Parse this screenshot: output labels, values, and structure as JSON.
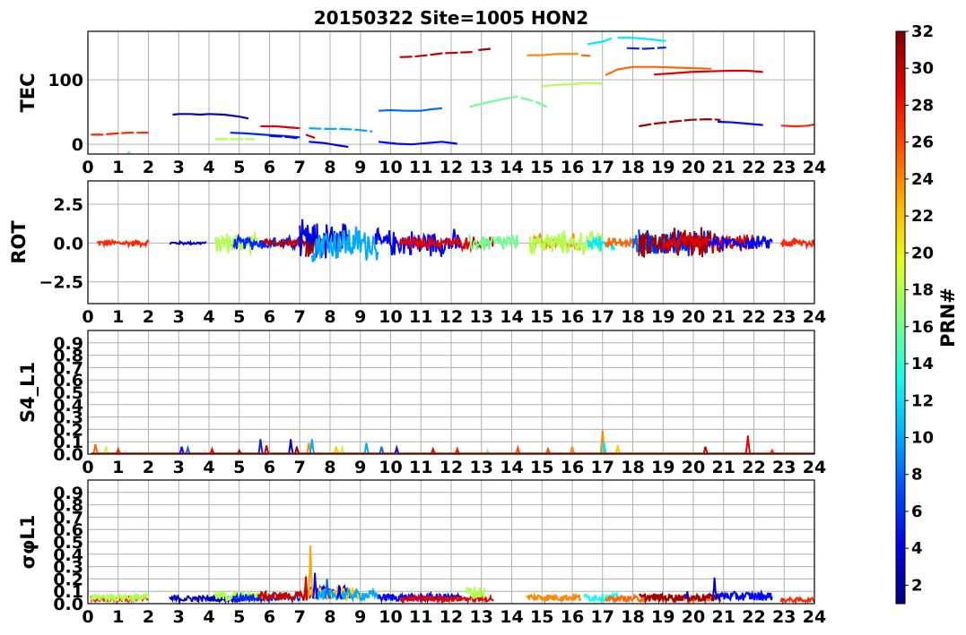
{
  "chart_data": {
    "title": "20150322 Site=1005 HON2",
    "x_range": [
      0,
      24
    ],
    "x_ticks": [
      "0",
      "1",
      "2",
      "3",
      "4",
      "5",
      "6",
      "7",
      "8",
      "9",
      "10",
      "11",
      "12",
      "13",
      "14",
      "15",
      "16",
      "17",
      "18",
      "19",
      "20",
      "21",
      "22",
      "23",
      "24"
    ],
    "grid": true,
    "colorbar": {
      "label": "PRN#",
      "colormap": "jet",
      "range": [
        1,
        32
      ],
      "ticks": [
        "2",
        "4",
        "6",
        "8",
        "10",
        "12",
        "14",
        "16",
        "18",
        "20",
        "22",
        "24",
        "26",
        "28",
        "30",
        "32"
      ]
    },
    "panels": [
      {
        "type": "line",
        "ylabel": "TEC",
        "ylim": [
          -15,
          175
        ],
        "y_ticks": [
          "0",
          "100"
        ],
        "series": [
          {
            "prn": 27,
            "x": [
              0.1,
              0.45,
              0.7,
              1.0,
              1.3,
              1.7,
              2.0
            ],
            "y": [
              15,
              15,
              16,
              17,
              18,
              18,
              18
            ]
          },
          {
            "prn": 15,
            "x": [
              1.3,
              1.4
            ],
            "y": [
              -13,
              -12
            ]
          },
          {
            "prn": 3,
            "x": [
              2.8,
              3.0,
              3.4,
              3.7,
              4.0,
              4.5,
              5.0,
              5.3
            ],
            "y": [
              46,
              47,
              47,
              46,
              47,
              46,
              43,
              40
            ]
          },
          {
            "prn": 18,
            "x": [
              4.2,
              4.6,
              5.0,
              5.5
            ],
            "y": [
              8,
              8,
              8,
              8
            ]
          },
          {
            "prn": 6,
            "x": [
              4.7,
              5.2,
              5.8,
              6.5,
              7.0
            ],
            "y": [
              18,
              17,
              15,
              13,
              11
            ]
          },
          {
            "prn": 29,
            "x": [
              5.7,
              6.2,
              6.7,
              7.0
            ],
            "y": [
              28,
              28,
              26,
              25
            ]
          },
          {
            "prn": 5,
            "x": [
              6.0,
              6.4,
              6.7,
              7.0
            ],
            "y": [
              13,
              12,
              11,
              9
            ]
          },
          {
            "prn": 30,
            "x": [
              7.2,
              7.5
            ],
            "y": [
              15,
              10
            ]
          },
          {
            "prn": 4,
            "x": [
              7.3,
              7.8,
              8.2,
              8.6
            ],
            "y": [
              4,
              2,
              -1,
              -4
            ]
          },
          {
            "prn": 10,
            "x": [
              7.3,
              7.8,
              8.3,
              8.8,
              9.4
            ],
            "y": [
              25,
              24,
              24,
              23,
              20
            ]
          },
          {
            "prn": 8,
            "x": [
              9.6,
              10.0,
              10.5,
              11.0,
              11.3,
              11.7
            ],
            "y": [
              52,
              53,
              52,
              52,
              54,
              56
            ]
          },
          {
            "prn": 5,
            "x": [
              9.6,
              10.2,
              10.7,
              11.2,
              11.7,
              12.2
            ],
            "y": [
              4,
              1,
              0,
              2,
              4,
              1
            ]
          },
          {
            "prn": 30,
            "x": [
              10.3,
              10.8,
              11.2,
              11.7,
              12.2,
              12.7
            ],
            "y": [
              135,
              136,
              138,
              141,
              142,
              143
            ]
          },
          {
            "prn": 31,
            "x": [
              12.9,
              13.3
            ],
            "y": [
              146,
              148
            ]
          },
          {
            "prn": 16,
            "x": [
              12.6,
              13.2,
              13.8,
              14.2
            ],
            "y": [
              58,
              65,
              71,
              74
            ]
          },
          {
            "prn": 16,
            "x": [
              14.3,
              14.8,
              15.2
            ],
            "y": [
              72,
              66,
              57
            ]
          },
          {
            "prn": 24,
            "x": [
              14.5,
              15.0,
              15.5,
              16.2
            ],
            "y": [
              138,
              138,
              140,
              140
            ]
          },
          {
            "prn": 18,
            "x": [
              15.0,
              15.5,
              16.0,
              16.5,
              17.0
            ],
            "y": [
              90,
              92,
              93,
              95,
              94
            ]
          },
          {
            "prn": 25,
            "x": [
              16.3,
              16.6
            ],
            "y": [
              138,
              137
            ]
          },
          {
            "prn": 12,
            "x": [
              16.5,
              17.0,
              17.3
            ],
            "y": [
              155,
              159,
              164
            ]
          },
          {
            "prn": 12,
            "x": [
              17.5,
              18.0,
              18.5,
              19.1
            ],
            "y": [
              165,
              165,
              163,
              160
            ]
          },
          {
            "prn": 6,
            "x": [
              17.8,
              18.4,
              19.1
            ],
            "y": [
              149,
              148,
              150
            ]
          },
          {
            "prn": 25,
            "x": [
              17.1,
              17.5,
              18.0,
              18.7,
              19.3,
              20.0,
              20.6
            ],
            "y": [
              107,
              116,
              120,
              120,
              119,
              118,
              117
            ]
          },
          {
            "prn": 29,
            "x": [
              18.7,
              19.3,
              19.9,
              20.5,
              21.2,
              21.8,
              22.3
            ],
            "y": [
              108,
              110,
              112,
              113,
              114,
              114,
              112
            ]
          },
          {
            "prn": 31,
            "x": [
              18.2,
              18.7,
              19.3,
              19.9,
              20.5,
              20.9
            ],
            "y": [
              28,
              32,
              35,
              38,
              39,
              38
            ]
          },
          {
            "prn": 5,
            "x": [
              20.8,
              21.3,
              21.8,
              22.3
            ],
            "y": [
              35,
              34,
              32,
              30
            ]
          },
          {
            "prn": 27,
            "x": [
              22.9,
              23.4,
              23.8,
              24.0
            ],
            "y": [
              29,
              28,
              29,
              31
            ]
          }
        ]
      },
      {
        "type": "line",
        "ylabel": "ROT",
        "ylim": [
          -3.9,
          4.0
        ],
        "y_ticks": [
          "−2.5",
          "0.0",
          "2.5"
        ],
        "noisy_segments": [
          {
            "prn": 27,
            "x": [
              0.3,
              2.0
            ],
            "amp": 0.25
          },
          {
            "prn": 3,
            "x": [
              2.7,
              3.9
            ],
            "amp": 0.12
          },
          {
            "prn": 18,
            "x": [
              4.2,
              5.6
            ],
            "amp": 0.9
          },
          {
            "prn": 6,
            "x": [
              4.8,
              7.0
            ],
            "amp": 0.5
          },
          {
            "prn": 30,
            "x": [
              5.7,
              7.4
            ],
            "amp": 0.35
          },
          {
            "prn": 4,
            "x": [
              7.0,
              8.6
            ],
            "amp": 1.6
          },
          {
            "prn": 31,
            "x": [
              7.2,
              7.7
            ],
            "amp": 1.3
          },
          {
            "prn": 10,
            "x": [
              7.4,
              9.6
            ],
            "amp": 1.4
          },
          {
            "prn": 5,
            "x": [
              9.5,
              12.3
            ],
            "amp": 1.0
          },
          {
            "prn": 29,
            "x": [
              10.3,
              13.4
            ],
            "amp": 0.5
          },
          {
            "prn": 16,
            "x": [
              12.6,
              14.2
            ],
            "amp": 0.7
          },
          {
            "prn": 24,
            "x": [
              14.6,
              16.3
            ],
            "amp": 0.7
          },
          {
            "prn": 18,
            "x": [
              14.6,
              17.0
            ],
            "amp": 0.9
          },
          {
            "prn": 12,
            "x": [
              16.5,
              17.4
            ],
            "amp": 0.6
          },
          {
            "prn": 25,
            "x": [
              17.1,
              18.6
            ],
            "amp": 0.4
          },
          {
            "prn": 8,
            "x": [
              18.0,
              20.0
            ],
            "amp": 0.9
          },
          {
            "prn": 6,
            "x": [
              18.2,
              20.5
            ],
            "amp": 1.0
          },
          {
            "prn": 31,
            "x": [
              18.2,
              20.9
            ],
            "amp": 1.1
          },
          {
            "prn": 29,
            "x": [
              19.0,
              22.0
            ],
            "amp": 0.6
          },
          {
            "prn": 5,
            "x": [
              20.5,
              22.6
            ],
            "amp": 0.5
          },
          {
            "prn": 27,
            "x": [
              22.9,
              24.0
            ],
            "amp": 0.4
          }
        ]
      },
      {
        "type": "line",
        "ylabel": "S4_L1",
        "ylim": [
          0.0,
          1.0
        ],
        "y_ticks": [
          "0.0",
          "0.1",
          "0.2",
          "0.3",
          "0.4",
          "0.5",
          "0.6",
          "0.7",
          "0.8",
          "0.9"
        ],
        "spikes": [
          {
            "prn": 25,
            "x": 0.25,
            "y": 0.08
          },
          {
            "prn": 18,
            "x": 0.6,
            "y": 0.06
          },
          {
            "prn": 27,
            "x": 1.0,
            "y": 0.04
          },
          {
            "prn": 5,
            "x": 3.1,
            "y": 0.06
          },
          {
            "prn": 8,
            "x": 3.3,
            "y": 0.05
          },
          {
            "prn": 29,
            "x": 4.1,
            "y": 0.04
          },
          {
            "prn": 30,
            "x": 5.0,
            "y": 0.03
          },
          {
            "prn": 6,
            "x": 5.7,
            "y": 0.12
          },
          {
            "prn": 30,
            "x": 5.9,
            "y": 0.07
          },
          {
            "prn": 3,
            "x": 6.7,
            "y": 0.12
          },
          {
            "prn": 31,
            "x": 6.9,
            "y": 0.06
          },
          {
            "prn": 24,
            "x": 7.3,
            "y": 0.09
          },
          {
            "prn": 10,
            "x": 7.4,
            "y": 0.12
          },
          {
            "prn": 22,
            "x": 8.2,
            "y": 0.06
          },
          {
            "prn": 18,
            "x": 8.4,
            "y": 0.05
          },
          {
            "prn": 10,
            "x": 9.2,
            "y": 0.09
          },
          {
            "prn": 8,
            "x": 9.7,
            "y": 0.06
          },
          {
            "prn": 5,
            "x": 10.2,
            "y": 0.05
          },
          {
            "prn": 29,
            "x": 11.4,
            "y": 0.04
          },
          {
            "prn": 28,
            "x": 12.2,
            "y": 0.04
          },
          {
            "prn": 16,
            "x": 13.2,
            "y": 0.03
          },
          {
            "prn": 26,
            "x": 14.2,
            "y": 0.05
          },
          {
            "prn": 26,
            "x": 15.2,
            "y": 0.04
          },
          {
            "prn": 24,
            "x": 16.0,
            "y": 0.06
          },
          {
            "prn": 24,
            "x": 17.0,
            "y": 0.19
          },
          {
            "prn": 12,
            "x": 17.05,
            "y": 0.1
          },
          {
            "prn": 22,
            "x": 17.5,
            "y": 0.07
          },
          {
            "prn": 30,
            "x": 20.4,
            "y": 0.06
          },
          {
            "prn": 29,
            "x": 21.8,
            "y": 0.15
          },
          {
            "prn": 27,
            "x": 22.6,
            "y": 0.03
          }
        ]
      },
      {
        "type": "line",
        "ylabel": "σφL1",
        "ylim": [
          0.0,
          1.0
        ],
        "y_ticks": [
          "0.0",
          "0.1",
          "0.2",
          "0.3",
          "0.4",
          "0.5",
          "0.6",
          "0.7",
          "0.8",
          "0.9"
        ],
        "base_segments": [
          {
            "prn": 27,
            "x": [
              0.1,
              2.0
            ],
            "base": 0.04
          },
          {
            "prn": 18,
            "x": [
              0.1,
              2.0
            ],
            "base": 0.05
          },
          {
            "prn": 3,
            "x": [
              2.7,
              5.4
            ],
            "base": 0.04
          },
          {
            "prn": 18,
            "x": [
              4.2,
              5.7
            ],
            "base": 0.06
          },
          {
            "prn": 6,
            "x": [
              4.8,
              7.0
            ],
            "base": 0.05
          },
          {
            "prn": 30,
            "x": [
              5.6,
              7.3
            ],
            "base": 0.06
          },
          {
            "prn": 4,
            "x": [
              7.2,
              8.7
            ],
            "base": 0.09
          },
          {
            "prn": 22,
            "x": [
              7.3,
              9.0
            ],
            "base": 0.08
          },
          {
            "prn": 10,
            "x": [
              7.5,
              9.6
            ],
            "base": 0.07
          },
          {
            "prn": 5,
            "x": [
              9.6,
              12.3
            ],
            "base": 0.05
          },
          {
            "prn": 29,
            "x": [
              10.3,
              13.4
            ],
            "base": 0.04
          },
          {
            "prn": 18,
            "x": [
              12.5,
              13.1
            ],
            "base": 0.09
          },
          {
            "prn": 24,
            "x": [
              14.5,
              16.3
            ],
            "base": 0.05
          },
          {
            "prn": 13,
            "x": [
              16.4,
              17.5
            ],
            "base": 0.05
          },
          {
            "prn": 25,
            "x": [
              17.1,
              20.7
            ],
            "base": 0.04
          },
          {
            "prn": 31,
            "x": [
              18.2,
              20.9
            ],
            "base": 0.05
          },
          {
            "prn": 5,
            "x": [
              20.8,
              22.6
            ],
            "base": 0.06
          },
          {
            "prn": 27,
            "x": [
              22.9,
              24.0
            ],
            "base": 0.03
          }
        ],
        "spikes": [
          {
            "prn": 29,
            "x": 7.2,
            "y": 0.22
          },
          {
            "prn": 23,
            "x": 7.35,
            "y": 0.47
          },
          {
            "prn": 5,
            "x": 7.5,
            "y": 0.25
          },
          {
            "prn": 8,
            "x": 7.9,
            "y": 0.2
          },
          {
            "prn": 4,
            "x": 8.3,
            "y": 0.15
          },
          {
            "prn": 3,
            "x": 20.7,
            "y": 0.21
          },
          {
            "prn": 5,
            "x": 19.8,
            "y": 0.1
          }
        ]
      }
    ]
  }
}
